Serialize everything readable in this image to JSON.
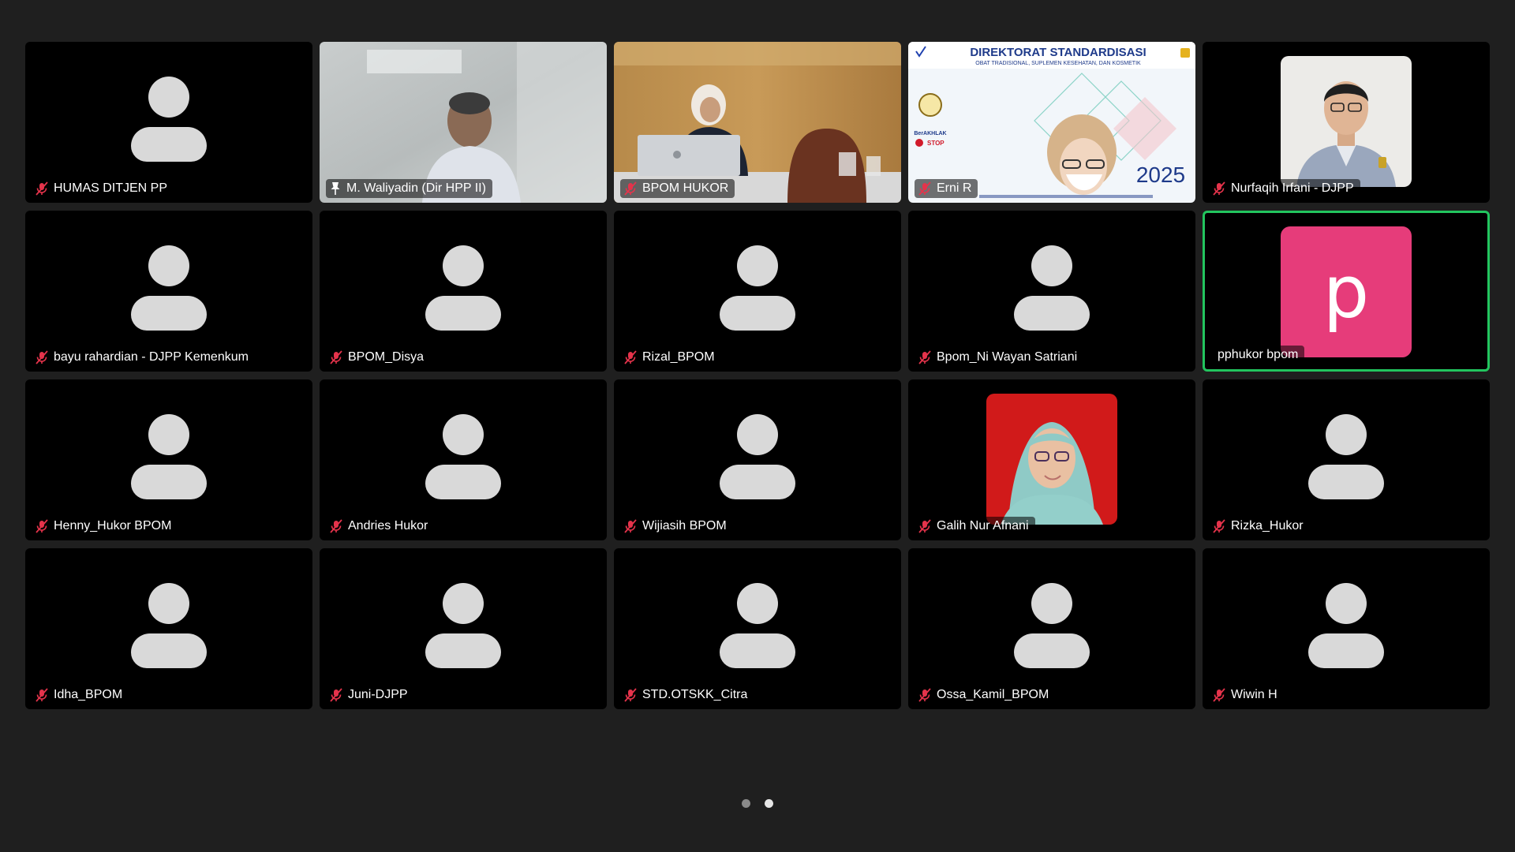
{
  "meeting": {
    "participants": [
      {
        "name": "HUMAS DITJEN PP",
        "video": "none",
        "mic": "muted"
      },
      {
        "name": "M. Waliyadin (Dir HPP II)",
        "video": "camera",
        "mic": "pinned"
      },
      {
        "name": "BPOM HUKOR",
        "video": "camera",
        "mic": "muted"
      },
      {
        "name": "Erni R",
        "video": "camera",
        "mic": "muted",
        "slide_title": "DIREKTORAT STANDARDISASI",
        "slide_subtitle": "OBAT TRADISIONAL, SUPLEMEN KESEHATAN, DAN KOSMETIK",
        "slide_year": "2025",
        "slide_badge": "BerAKHLAK",
        "slide_stop": "STOP"
      },
      {
        "name": "Nurfaqih Irfani - DJPP",
        "video": "photo",
        "mic": "muted"
      },
      {
        "name": "bayu rahardian - DJPP Kemenkum",
        "video": "none",
        "mic": "muted"
      },
      {
        "name": "BPOM_Disya",
        "video": "none",
        "mic": "muted"
      },
      {
        "name": "Rizal_BPOM",
        "video": "none",
        "mic": "muted"
      },
      {
        "name": "Bpom_Ni Wayan Satriani",
        "video": "none",
        "mic": "muted"
      },
      {
        "name": "pphukor bpom",
        "video": "letter",
        "letter": "p",
        "mic": "none",
        "active_speaker": true
      },
      {
        "name": "Henny_Hukor BPOM",
        "video": "none",
        "mic": "muted"
      },
      {
        "name": "Andries Hukor",
        "video": "none",
        "mic": "muted"
      },
      {
        "name": "Wijiasih BPOM",
        "video": "none",
        "mic": "muted"
      },
      {
        "name": "Galih Nur Afnani",
        "video": "photo",
        "mic": "muted"
      },
      {
        "name": "Rizka_Hukor",
        "video": "none",
        "mic": "muted"
      },
      {
        "name": "Idha_BPOM",
        "video": "none",
        "mic": "muted"
      },
      {
        "name": "Juni-DJPP",
        "video": "none",
        "mic": "muted"
      },
      {
        "name": "STD.OTSKK_Citra",
        "video": "none",
        "mic": "muted"
      },
      {
        "name": "Ossa_Kamil_BPOM",
        "video": "none",
        "mic": "muted"
      },
      {
        "name": "Wiwin H",
        "video": "none",
        "mic": "muted"
      }
    ]
  },
  "colors": {
    "background": "#1f1f1f",
    "tile": "#000000",
    "active_border": "#22c55e",
    "muted_mic": "#e5334b",
    "avatar_gray": "#d9d9d9",
    "letter_avatar": "#e63c7a"
  },
  "pager": {
    "pages": 2,
    "current": 2
  }
}
